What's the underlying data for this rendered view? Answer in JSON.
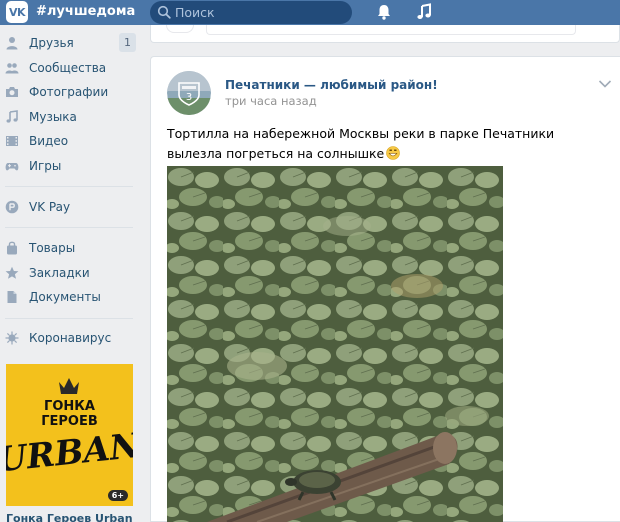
{
  "header": {
    "logo_text": "VK",
    "hashtag": "#лучшедома",
    "search_placeholder": "Поиск"
  },
  "sidebar": {
    "items": [
      {
        "label": "Друзья",
        "icon": "user-icon",
        "badge": "1"
      },
      {
        "label": "Сообщества",
        "icon": "users-icon"
      },
      {
        "label": "Фотографии",
        "icon": "camera-icon"
      },
      {
        "label": "Музыка",
        "icon": "music-icon"
      },
      {
        "label": "Видео",
        "icon": "video-icon"
      },
      {
        "label": "Игры",
        "icon": "gamepad-icon"
      },
      {
        "label": "VK Pay",
        "icon": "vkpay-icon"
      },
      {
        "label": "Товары",
        "icon": "bag-icon"
      },
      {
        "label": "Закладки",
        "icon": "star-icon"
      },
      {
        "label": "Документы",
        "icon": "document-icon"
      },
      {
        "label": "Коронавирус",
        "icon": "virus-icon"
      }
    ],
    "promo": {
      "line1": "ГОНКА",
      "line2": "ГЕРОЕВ",
      "line3": "URBAN",
      "age": "6+",
      "caption": "Гонка Героев Urban"
    }
  },
  "post": {
    "author": "Печатники — любимый район!",
    "time": "три часа назад",
    "text": "Тортилла на набережной Москвы реки в парке Печатники вылезла погреться на солнышке",
    "avatar_label": "3"
  },
  "colors": {
    "header": "#4a76a8",
    "link": "#2a5885",
    "nav_text": "#285473",
    "page_bg": "#edeef0",
    "promo_bg": "#f3c11c"
  }
}
